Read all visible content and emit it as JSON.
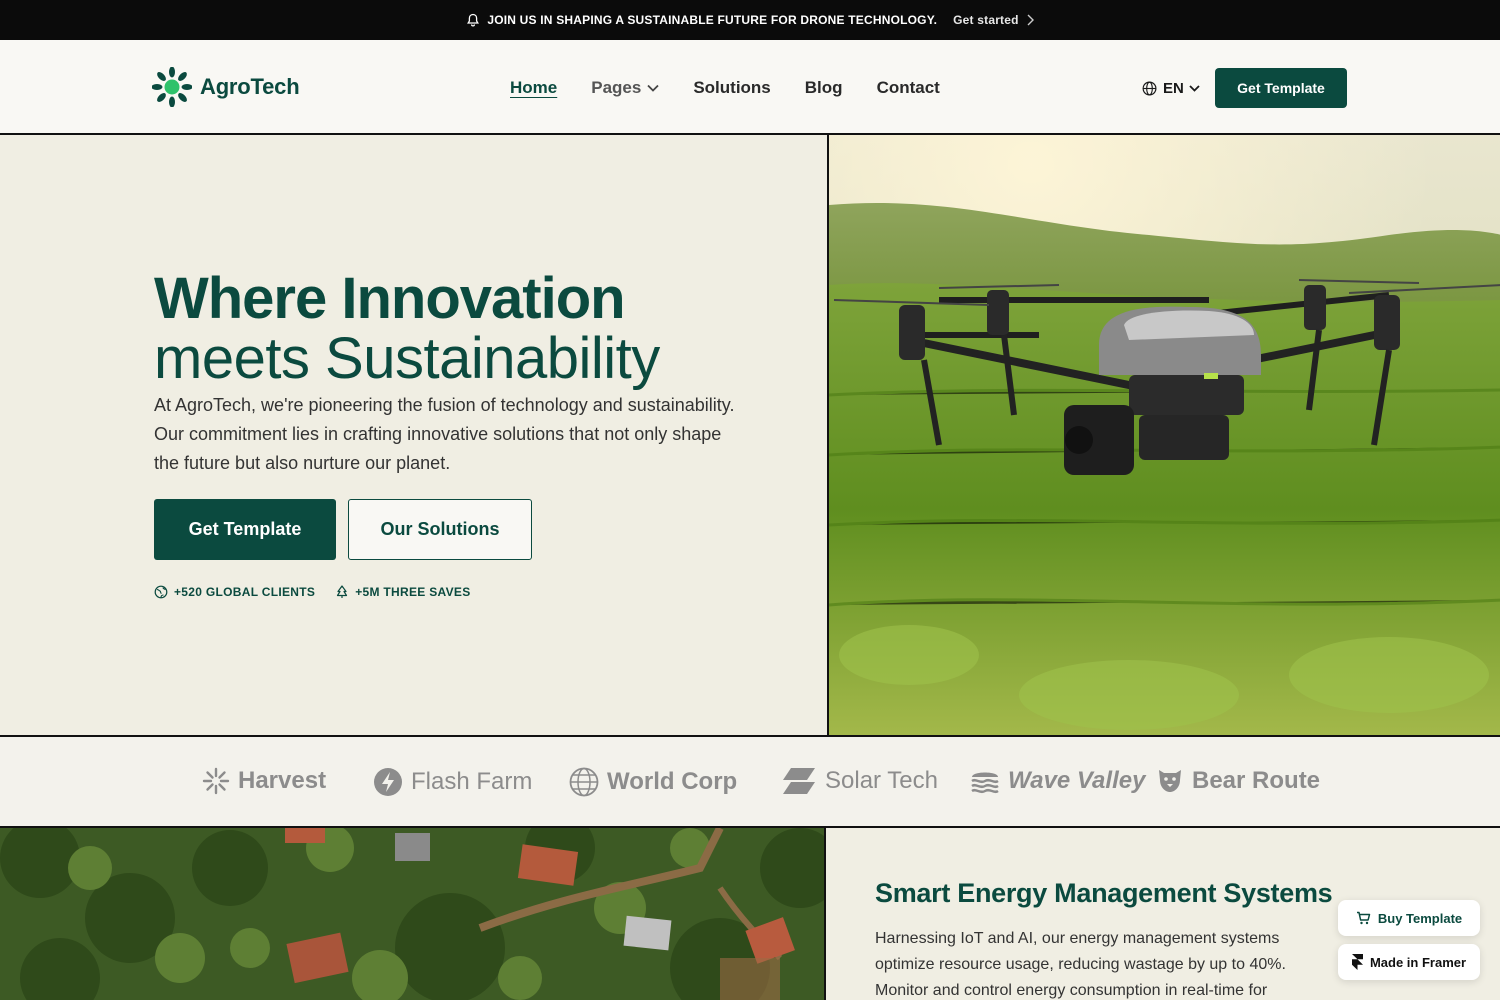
{
  "announcement": {
    "icon": "bell-icon",
    "text": "JOIN US IN SHAPING A SUSTAINABLE FUTURE FOR DRONE TECHNOLOGY.",
    "link_label": "Get started"
  },
  "header": {
    "brand": "AgroTech",
    "nav": [
      {
        "label": "Home",
        "active": true
      },
      {
        "label": "Pages",
        "has_dropdown": true
      },
      {
        "label": "Solutions"
      },
      {
        "label": "Blog"
      },
      {
        "label": "Contact"
      }
    ],
    "language": "EN",
    "cta_label": "Get Template"
  },
  "hero": {
    "title_line1": "Where Innovation",
    "title_line2": "meets Sustainability",
    "description": "At AgroTech, we're pioneering the fusion of technology and sustainability. Our commitment lies in crafting innovative solutions that not only shape the future but also nurture our planet.",
    "primary_button": "Get Template",
    "secondary_button": "Our Solutions",
    "stats": [
      {
        "icon": "globe-icon",
        "label": "+520 GLOBAL CLIENTS"
      },
      {
        "icon": "tree-icon",
        "label": "+5M THREE SAVES"
      }
    ]
  },
  "partners": [
    "Harvest",
    "Flash Farm",
    "World Corp",
    "Solar Tech",
    "Wave Valley",
    "Bear Route"
  ],
  "feature": {
    "title": "Smart Energy Management Systems",
    "description": "Harnessing IoT and AI, our energy management systems optimize resource usage, reducing wastage by up to 40%. Monitor and control energy consumption in real-time for"
  },
  "floating": {
    "buy_label": "Buy Template",
    "framer_label": "Made in Framer"
  },
  "colors": {
    "brand_green": "#0b4a3f",
    "background": "#f0eee3",
    "accent_green": "#2ec26b"
  }
}
